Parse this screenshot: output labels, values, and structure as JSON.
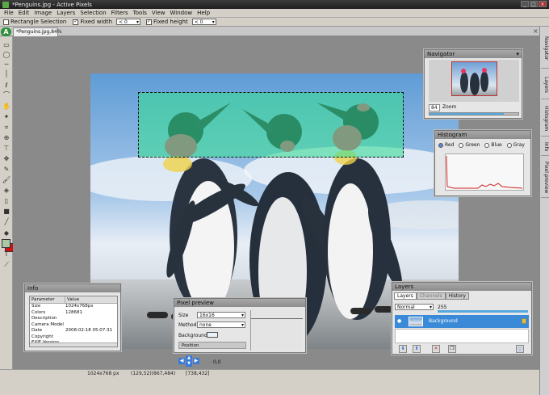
{
  "window": {
    "title": "*Penguins.jpg - Active Pixels",
    "minimize": "_",
    "maximize": "□",
    "close": "×"
  },
  "menu": [
    "File",
    "Edit",
    "Image",
    "Layers",
    "Selection",
    "Filters",
    "Tools",
    "View",
    "Window",
    "Help"
  ],
  "options": {
    "rect_selection": "Rectangle Selection",
    "fixed_width": "Fixed width",
    "fixed_width_value": "< 0",
    "fixed_height": "Fixed height",
    "fixed_height_value": "< 0"
  },
  "document": {
    "app_logo": "A",
    "tab": "*Penguins.jpg,84%",
    "tab_close": "×"
  },
  "right_tabs": [
    "Navigator",
    "Layers",
    "Histogram",
    "Info",
    "Pixel preview"
  ],
  "navigator": {
    "title": "Navigator",
    "zoom_value": "84",
    "zoom_label": "Zoom",
    "zoom_fraction": 0.84
  },
  "histogram": {
    "title": "Histogram",
    "channels": [
      "Red",
      "Green",
      "Blue",
      "Gray"
    ],
    "selected": "Red",
    "line_color": "#d02020"
  },
  "info": {
    "title": "Info",
    "headers": [
      "Parameter",
      "Value"
    ],
    "rows": [
      [
        "Size",
        "1024x768px"
      ],
      [
        "Colors",
        "128681"
      ],
      [
        "Description",
        ""
      ],
      [
        "Camera Model",
        ""
      ],
      [
        "Date",
        "2008:02:18 05:07:31"
      ],
      [
        "Copyright",
        ""
      ],
      [
        "EXIF Version",
        ""
      ]
    ]
  },
  "pixel_preview": {
    "title": "Pixel preview",
    "size_label": "Size",
    "size_value": "16x16",
    "method_label": "Method",
    "method_value": "none",
    "background_label": "Background:",
    "position_label": "Position",
    "coords": "0,0"
  },
  "layers": {
    "title": "Layers",
    "tabs": [
      "Layers",
      "Channels",
      "History"
    ],
    "blend_mode": "Normal",
    "opacity": "255",
    "items": [
      {
        "name": "Background"
      }
    ]
  },
  "status": {
    "size": "1024x768 px",
    "cursor": "(129,52)(867,484)",
    "selection": "[738,432]"
  },
  "colors": {
    "accent": "#3a8ad8",
    "selection_tint": "#3adc96",
    "foreground": "#a9c9a4",
    "background": "#d01010"
  }
}
